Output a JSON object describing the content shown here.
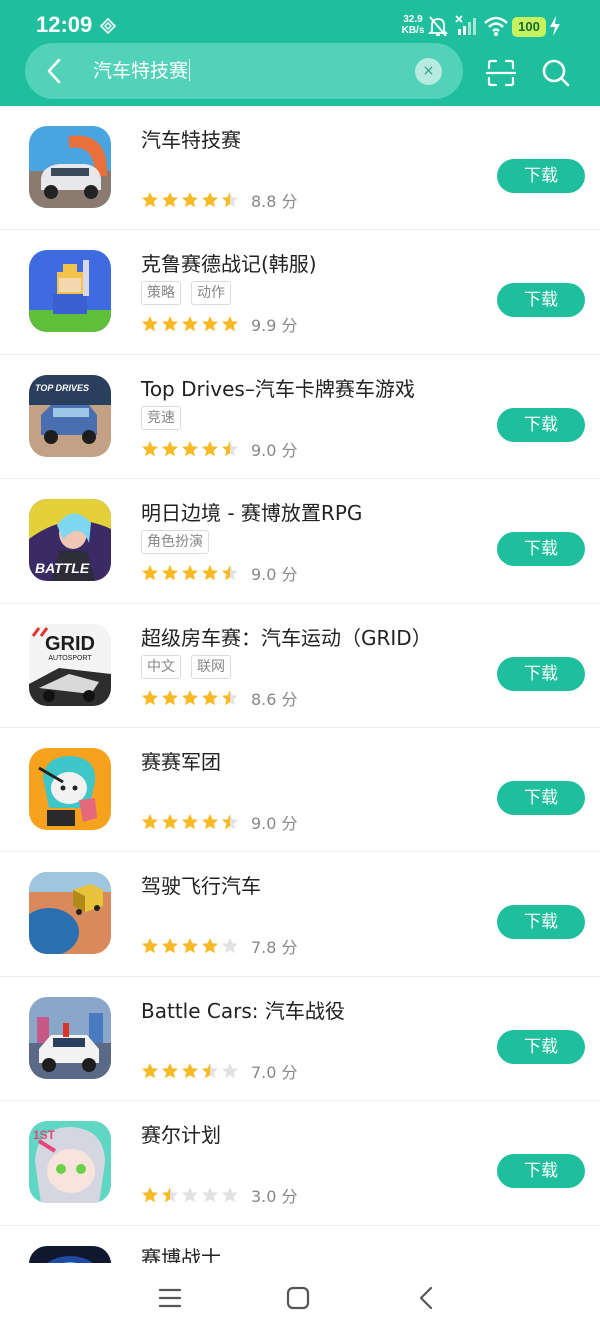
{
  "status_bar": {
    "time": "12:09",
    "net_speed_value": "32.9",
    "net_speed_unit": "KB/s",
    "battery": "100",
    "icons": [
      "nfc-icon",
      "mute-icon",
      "no-signal-icon",
      "wifi-icon",
      "charging-icon"
    ]
  },
  "search": {
    "query": "汽车特技赛",
    "clear_label": "×",
    "icons": [
      "back-arrow-icon",
      "clear-icon",
      "scan-icon",
      "search-icon"
    ]
  },
  "colors": {
    "accent": "#1fbf9e",
    "star_full": "#f7b924",
    "star_empty": "#e2e2e2"
  },
  "apps": [
    {
      "name": "汽车特技赛",
      "tags": [],
      "rating": 4.5,
      "score": "8.8 分",
      "button": "下载"
    },
    {
      "name": "克鲁赛德战记(韩服)",
      "tags": [
        "策略",
        "动作"
      ],
      "rating": 5,
      "score": "9.9 分",
      "button": "下载"
    },
    {
      "name": "Top Drives–汽车卡牌赛车游戏",
      "tags": [
        "竞速"
      ],
      "rating": 4.5,
      "score": "9.0 分",
      "button": "下载"
    },
    {
      "name": "明日边境 - 赛博放置RPG",
      "tags": [
        "角色扮演"
      ],
      "rating": 4.5,
      "score": "9.0 分",
      "button": "下载"
    },
    {
      "name": "超级房车赛：汽车运动（GRID）",
      "tags": [
        "中文",
        "联网"
      ],
      "rating": 4.5,
      "score": "8.6 分",
      "button": "下载"
    },
    {
      "name": "赛赛军团",
      "tags": [],
      "rating": 4.5,
      "score": "9.0 分",
      "button": "下载"
    },
    {
      "name": "驾驶飞行汽车",
      "tags": [],
      "rating": 4,
      "score": "7.8 分",
      "button": "下载"
    },
    {
      "name": "Battle Cars: 汽车战役",
      "tags": [],
      "rating": 3.5,
      "score": "7.0 分",
      "button": "下载"
    },
    {
      "name": "赛尔计划",
      "tags": [],
      "rating": 1.5,
      "score": "3.0 分",
      "button": "下载"
    },
    {
      "name": "赛博战士",
      "tags": [],
      "rating": null,
      "score": "",
      "button": ""
    }
  ],
  "icon_text": {
    "top_drives": "TOP DRIVES",
    "grid_logo": "GRID",
    "grid_sub": "AUTOSPORT",
    "battle": "BATTLE",
    "first": "1ST"
  },
  "nav": {
    "icons": [
      "menu-icon",
      "home-icon",
      "back-icon"
    ]
  }
}
